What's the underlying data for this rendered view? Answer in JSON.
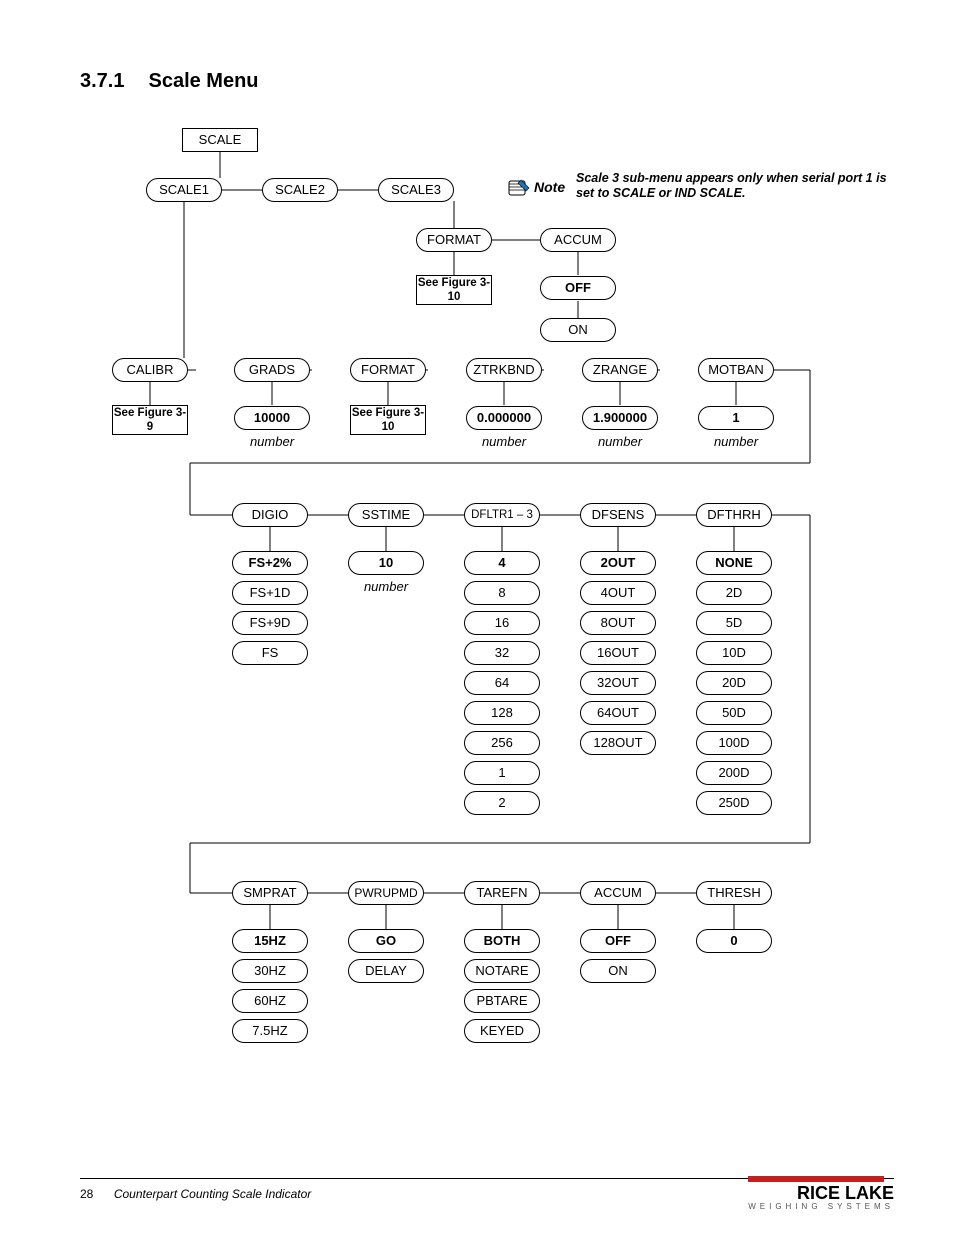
{
  "heading": {
    "number": "3.7.1",
    "title": "Scale Menu"
  },
  "note": {
    "label": "Note",
    "text": "Scale 3 sub-menu appears only when serial port 1 is set to SCALE or IND SCALE."
  },
  "top": {
    "scale": "SCALE",
    "s1": "SCALE1",
    "s2": "SCALE2",
    "s3": "SCALE3",
    "format": "FORMAT",
    "accum": "ACCUM",
    "off": "OFF",
    "on": "ON",
    "seefig310": "See Figure 3-10"
  },
  "row1": {
    "calibr": "CALIBR",
    "grads": "GRADS",
    "format": "FORMAT",
    "ztrkbnd": "ZTRKBND",
    "zrange": "ZRANGE",
    "motban": "MOTBAN",
    "seefig39": "See Figure 3-9",
    "v_grads": "10000",
    "seefig310": "See Figure 3-10",
    "v_ztrkbnd": "0.000000",
    "v_zrange": "1.900000",
    "v_motban": "1",
    "lbl_number": "number"
  },
  "row2": {
    "digio": "DIGIO",
    "sstime": "SSTIME",
    "dfltr": "DFLTR1 – 3",
    "dfsens": "DFSENS",
    "dfthrh": "DFTHRH",
    "digio_opts": [
      "FS+2%",
      "FS+1D",
      "FS+9D",
      "FS"
    ],
    "sstime_v": "10",
    "sstime_lbl": "number",
    "dfltr_opts": [
      "4",
      "8",
      "16",
      "32",
      "64",
      "128",
      "256",
      "1",
      "2"
    ],
    "dfsens_opts": [
      "2OUT",
      "4OUT",
      "8OUT",
      "16OUT",
      "32OUT",
      "64OUT",
      "128OUT"
    ],
    "dfthrh_opts": [
      "NONE",
      "2D",
      "5D",
      "10D",
      "20D",
      "50D",
      "100D",
      "200D",
      "250D"
    ]
  },
  "row3": {
    "smprat": "SMPRAT",
    "pwrupmd": "PWRUPMD",
    "tarefn": "TAREFN",
    "accum": "ACCUM",
    "thresh": "THRESH",
    "smprat_opts": [
      "15HZ",
      "30HZ",
      "60HZ",
      "7.5HZ"
    ],
    "pwrupmd_opts": [
      "GO",
      "DELAY"
    ],
    "tarefn_opts": [
      "BOTH",
      "NOTARE",
      "PBTARE",
      "KEYED"
    ],
    "accum_opts": [
      "OFF",
      "ON"
    ],
    "thresh_v": "0"
  },
  "footer": {
    "page": "28",
    "title": "Counterpart Counting Scale Indicator"
  },
  "logo": {
    "name": "RICE LAKE",
    "sub": "WEIGHING SYSTEMS"
  },
  "chart_data": {
    "type": "tree-diagram",
    "root": "SCALE",
    "scales": [
      "SCALE1",
      "SCALE2",
      "SCALE3"
    ],
    "scale3_note": "Scale 3 sub-menu appears only when serial port 1 is set to SCALE or IND SCALE.",
    "scale3_children": {
      "FORMAT": "See Figure 3-10",
      "ACCUM": [
        "OFF",
        "ON"
      ]
    },
    "scale1_params": [
      {
        "name": "CALIBR",
        "value": "See Figure 3-9"
      },
      {
        "name": "GRADS",
        "value": "10000",
        "type": "number"
      },
      {
        "name": "FORMAT",
        "value": "See Figure 3-10"
      },
      {
        "name": "ZTRKBND",
        "value": "0.000000",
        "type": "number"
      },
      {
        "name": "ZRANGE",
        "value": "1.900000",
        "type": "number"
      },
      {
        "name": "MOTBAN",
        "value": "1",
        "type": "number"
      },
      {
        "name": "DIGIO",
        "options": [
          "FS+2%",
          "FS+1D",
          "FS+9D",
          "FS"
        ],
        "default": "FS+2%"
      },
      {
        "name": "SSTIME",
        "value": "10",
        "type": "number"
      },
      {
        "name": "DFLTR1 – 3",
        "options": [
          "4",
          "8",
          "16",
          "32",
          "64",
          "128",
          "256",
          "1",
          "2"
        ],
        "default": "4"
      },
      {
        "name": "DFSENS",
        "options": [
          "2OUT",
          "4OUT",
          "8OUT",
          "16OUT",
          "32OUT",
          "64OUT",
          "128OUT"
        ],
        "default": "2OUT"
      },
      {
        "name": "DFTHRH",
        "options": [
          "NONE",
          "2D",
          "5D",
          "10D",
          "20D",
          "50D",
          "100D",
          "200D",
          "250D"
        ],
        "default": "NONE"
      },
      {
        "name": "SMPRAT",
        "options": [
          "15HZ",
          "30HZ",
          "60HZ",
          "7.5HZ"
        ],
        "default": "15HZ"
      },
      {
        "name": "PWRUPMD",
        "options": [
          "GO",
          "DELAY"
        ],
        "default": "GO"
      },
      {
        "name": "TAREFN",
        "options": [
          "BOTH",
          "NOTARE",
          "PBTARE",
          "KEYED"
        ],
        "default": "BOTH"
      },
      {
        "name": "ACCUM",
        "options": [
          "OFF",
          "ON"
        ],
        "default": "OFF"
      },
      {
        "name": "THRESH",
        "value": "0"
      }
    ]
  }
}
